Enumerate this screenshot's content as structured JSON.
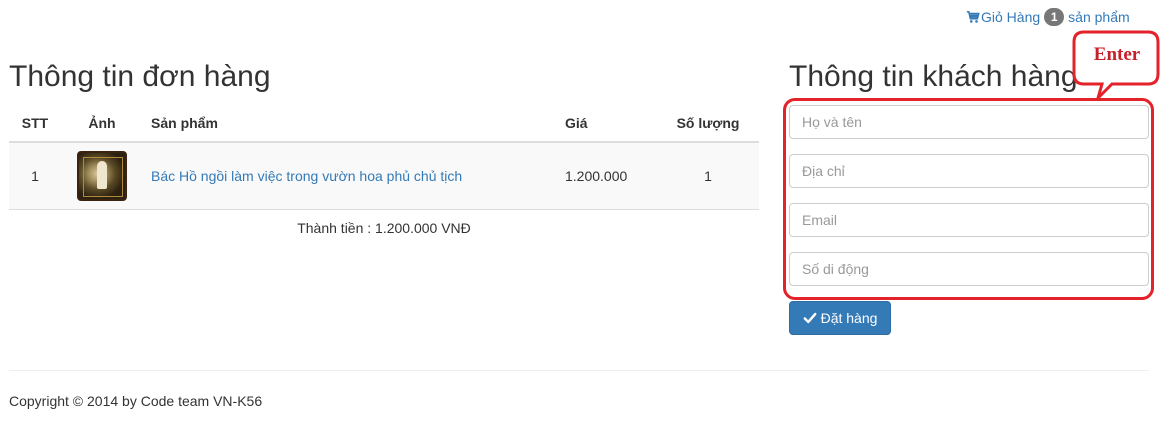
{
  "header": {
    "cart": {
      "label": "Giỏ Hàng",
      "count": "1",
      "suffix": "sản phẩm"
    }
  },
  "order": {
    "title": "Thông tin đơn hàng",
    "columns": {
      "stt": "STT",
      "image": "Ảnh",
      "product": "Sản phẩm",
      "price": "Giá",
      "quantity": "Số lượng"
    },
    "rows": [
      {
        "stt": "1",
        "product": "Bác Hồ ngồi làm việc trong vườn hoa phủ chủ tịch",
        "price": "1.200.000",
        "quantity": "1"
      }
    ],
    "total": "Thành tiền : 1.200.000 VNĐ"
  },
  "customer": {
    "title": "Thông tin khách hàng",
    "fields": {
      "name": {
        "placeholder": "Họ và tên",
        "value": ""
      },
      "address": {
        "placeholder": "Địa chỉ",
        "value": ""
      },
      "email": {
        "placeholder": "Email",
        "value": ""
      },
      "phone": {
        "placeholder": "Số di động",
        "value": ""
      }
    },
    "submit_label": "Đặt hàng"
  },
  "annotation": {
    "text": "Enter",
    "color": "#e32329"
  },
  "footer": {
    "copyright": "Copyright © 2014 by Code team VN-K56"
  },
  "colors": {
    "link": "#337ab7",
    "primary_button": "#337ab7",
    "badge": "#777777",
    "annotation_red": "#e32329"
  },
  "icons": {
    "cart": "shopping-cart-icon",
    "submit": "check-icon"
  }
}
